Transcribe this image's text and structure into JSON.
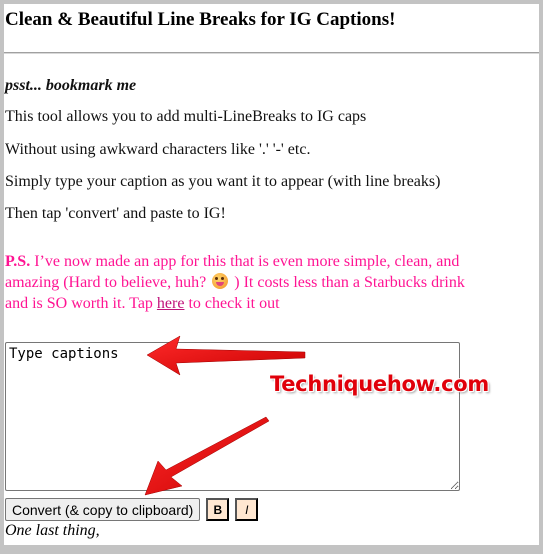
{
  "page": {
    "title": "Clean & Beautiful Line Breaks for IG Captions!",
    "bookmark_note": "psst... bookmark me",
    "intro_lines": [
      "This tool allows you to add multi-LineBreaks to IG caps",
      "Without using awkward characters like '.' '-' etc.",
      "Simply type your caption as you want it to appear (with line breaks)",
      "Then tap 'convert' and paste to IG!"
    ],
    "ps": {
      "label": "P.S.",
      "text_before_emoji": " I’ve now made an app for this that is even more simple, clean, and amazing (Hard to believe, huh? ",
      "emoji_icon": "winking-face-with-tongue",
      "text_after_emoji": " ) It costs less than a Starbucks drink and is SO worth it. Tap ",
      "link_text": "here",
      "text_after_link": " to check it out",
      "color": "#ff1493"
    },
    "caption_input": {
      "value": "Type captions"
    },
    "buttons": {
      "convert_label": "Convert (& copy to clipboard)",
      "bold_label": "B",
      "italic_label": "I"
    },
    "footer_text": "One last thing,"
  },
  "annotations": {
    "watermark": "Techniquehow.com",
    "arrow_color": "#e60000"
  }
}
